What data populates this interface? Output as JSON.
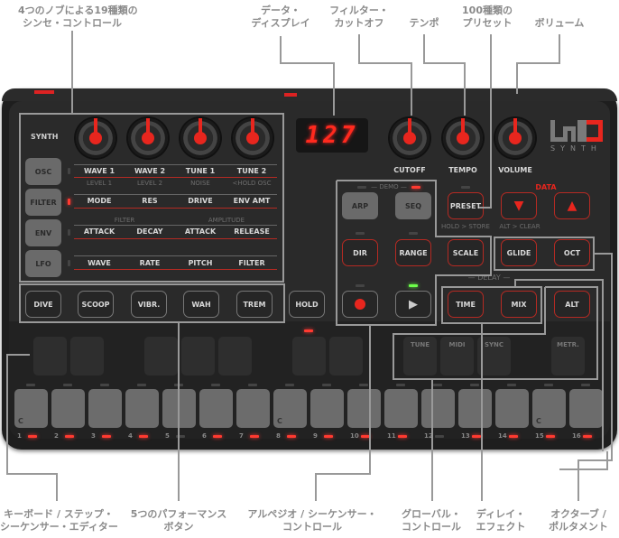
{
  "callouts": {
    "synth_controls": [
      "4つのノブによる19種類の",
      "シンセ・コントロール"
    ],
    "data_display": [
      "データ・",
      "ディスプレイ"
    ],
    "filter_cutoff": [
      "フィルター・",
      "カットオフ"
    ],
    "tempo": [
      "テンポ"
    ],
    "presets": [
      "100種類の",
      "プリセット"
    ],
    "volume": [
      "ボリューム"
    ],
    "keyboard_step": [
      "キーボード / ステップ・",
      "シーケンサー・エディター"
    ],
    "performance_buttons": [
      "5つのパフォーマンス",
      "ボタン"
    ],
    "arp_seq": [
      "アルペジオ / シーケンサー・",
      "コントロール"
    ],
    "global": [
      "グローバル・",
      "コントロール"
    ],
    "delay": [
      "ディレイ・",
      "エフェクト"
    ],
    "octave_portamento": [
      "オクターブ /",
      "ポルタメント"
    ]
  },
  "device": {
    "synth_label": "SYNTH",
    "display_value": "127",
    "logo_text": "SYNTH",
    "colors": {
      "accent": "#e8261e",
      "body": "#1e1e1e",
      "panel": "#2a2a2a",
      "button_gray": "#6a6a6a",
      "led_green": "#6dff4a"
    },
    "mode_buttons": [
      {
        "label": "OSC",
        "led": false
      },
      {
        "label": "FILTER",
        "led": true
      },
      {
        "label": "ENV",
        "led": false
      },
      {
        "label": "LFO",
        "led": false
      }
    ],
    "knob_rows": [
      {
        "main": [
          "WAVE 1",
          "WAVE 2",
          "TUNE 1",
          "TUNE 2"
        ],
        "sub": [
          "LEVEL 1",
          "LEVEL 2",
          "NOISE",
          "<HOLD OSC"
        ]
      },
      {
        "main": [
          "MODE",
          "RES",
          "DRIVE",
          "ENV AMT"
        ],
        "sub": []
      },
      {
        "main": [
          "ATTACK",
          "DECAY",
          "ATTACK",
          "RELEASE"
        ],
        "group_labels": [
          "FILTER",
          "AMPLITUDE"
        ]
      },
      {
        "main": [
          "WAVE",
          "RATE",
          "PITCH",
          "FILTER"
        ],
        "sub": []
      }
    ],
    "right_knobs": [
      "CUTOFF",
      "TEMPO",
      "VOLUME"
    ],
    "demo_label": "DEMO",
    "arp_label": "ARP",
    "seq_label": "SEQ",
    "dir_label": "DIR",
    "range_label": "RANGE",
    "scale_label": "SCALE",
    "preset_label": "PRESET",
    "preset_sub": "HOLD > STORE",
    "data_label": "DATA",
    "data_sub": "ALT > CLEAR",
    "glide_label": "GLIDE",
    "oct_label": "OCT",
    "delay_label": "DELAY",
    "time_label": "TIME",
    "mix_label": "MIX",
    "alt_label": "ALT",
    "hold_label": "HOLD",
    "performance": [
      "DIVE",
      "SCOOP",
      "VIBR.",
      "WAH",
      "TREM"
    ],
    "global_pads": [
      "TUNE",
      "MIDI",
      "SYNC"
    ],
    "metr_label": "METR.",
    "keys": [
      {
        "num": "1",
        "note": "C",
        "led": true
      },
      {
        "num": "2",
        "note": "",
        "led": true
      },
      {
        "num": "3",
        "note": "",
        "led": true
      },
      {
        "num": "4",
        "note": "",
        "led": true
      },
      {
        "num": "5",
        "note": "",
        "led": false
      },
      {
        "num": "6",
        "note": "",
        "led": true
      },
      {
        "num": "7",
        "note": "",
        "led": true
      },
      {
        "num": "8",
        "note": "C",
        "led": true
      },
      {
        "num": "9",
        "note": "",
        "led": true
      },
      {
        "num": "10",
        "note": "",
        "led": true
      },
      {
        "num": "11",
        "note": "",
        "led": true
      },
      {
        "num": "12",
        "note": "",
        "led": false
      },
      {
        "num": "13",
        "note": "",
        "led": true
      },
      {
        "num": "14",
        "note": "",
        "led": true
      },
      {
        "num": "15",
        "note": "C",
        "led": true
      },
      {
        "num": "16",
        "note": "",
        "led": true
      }
    ]
  }
}
